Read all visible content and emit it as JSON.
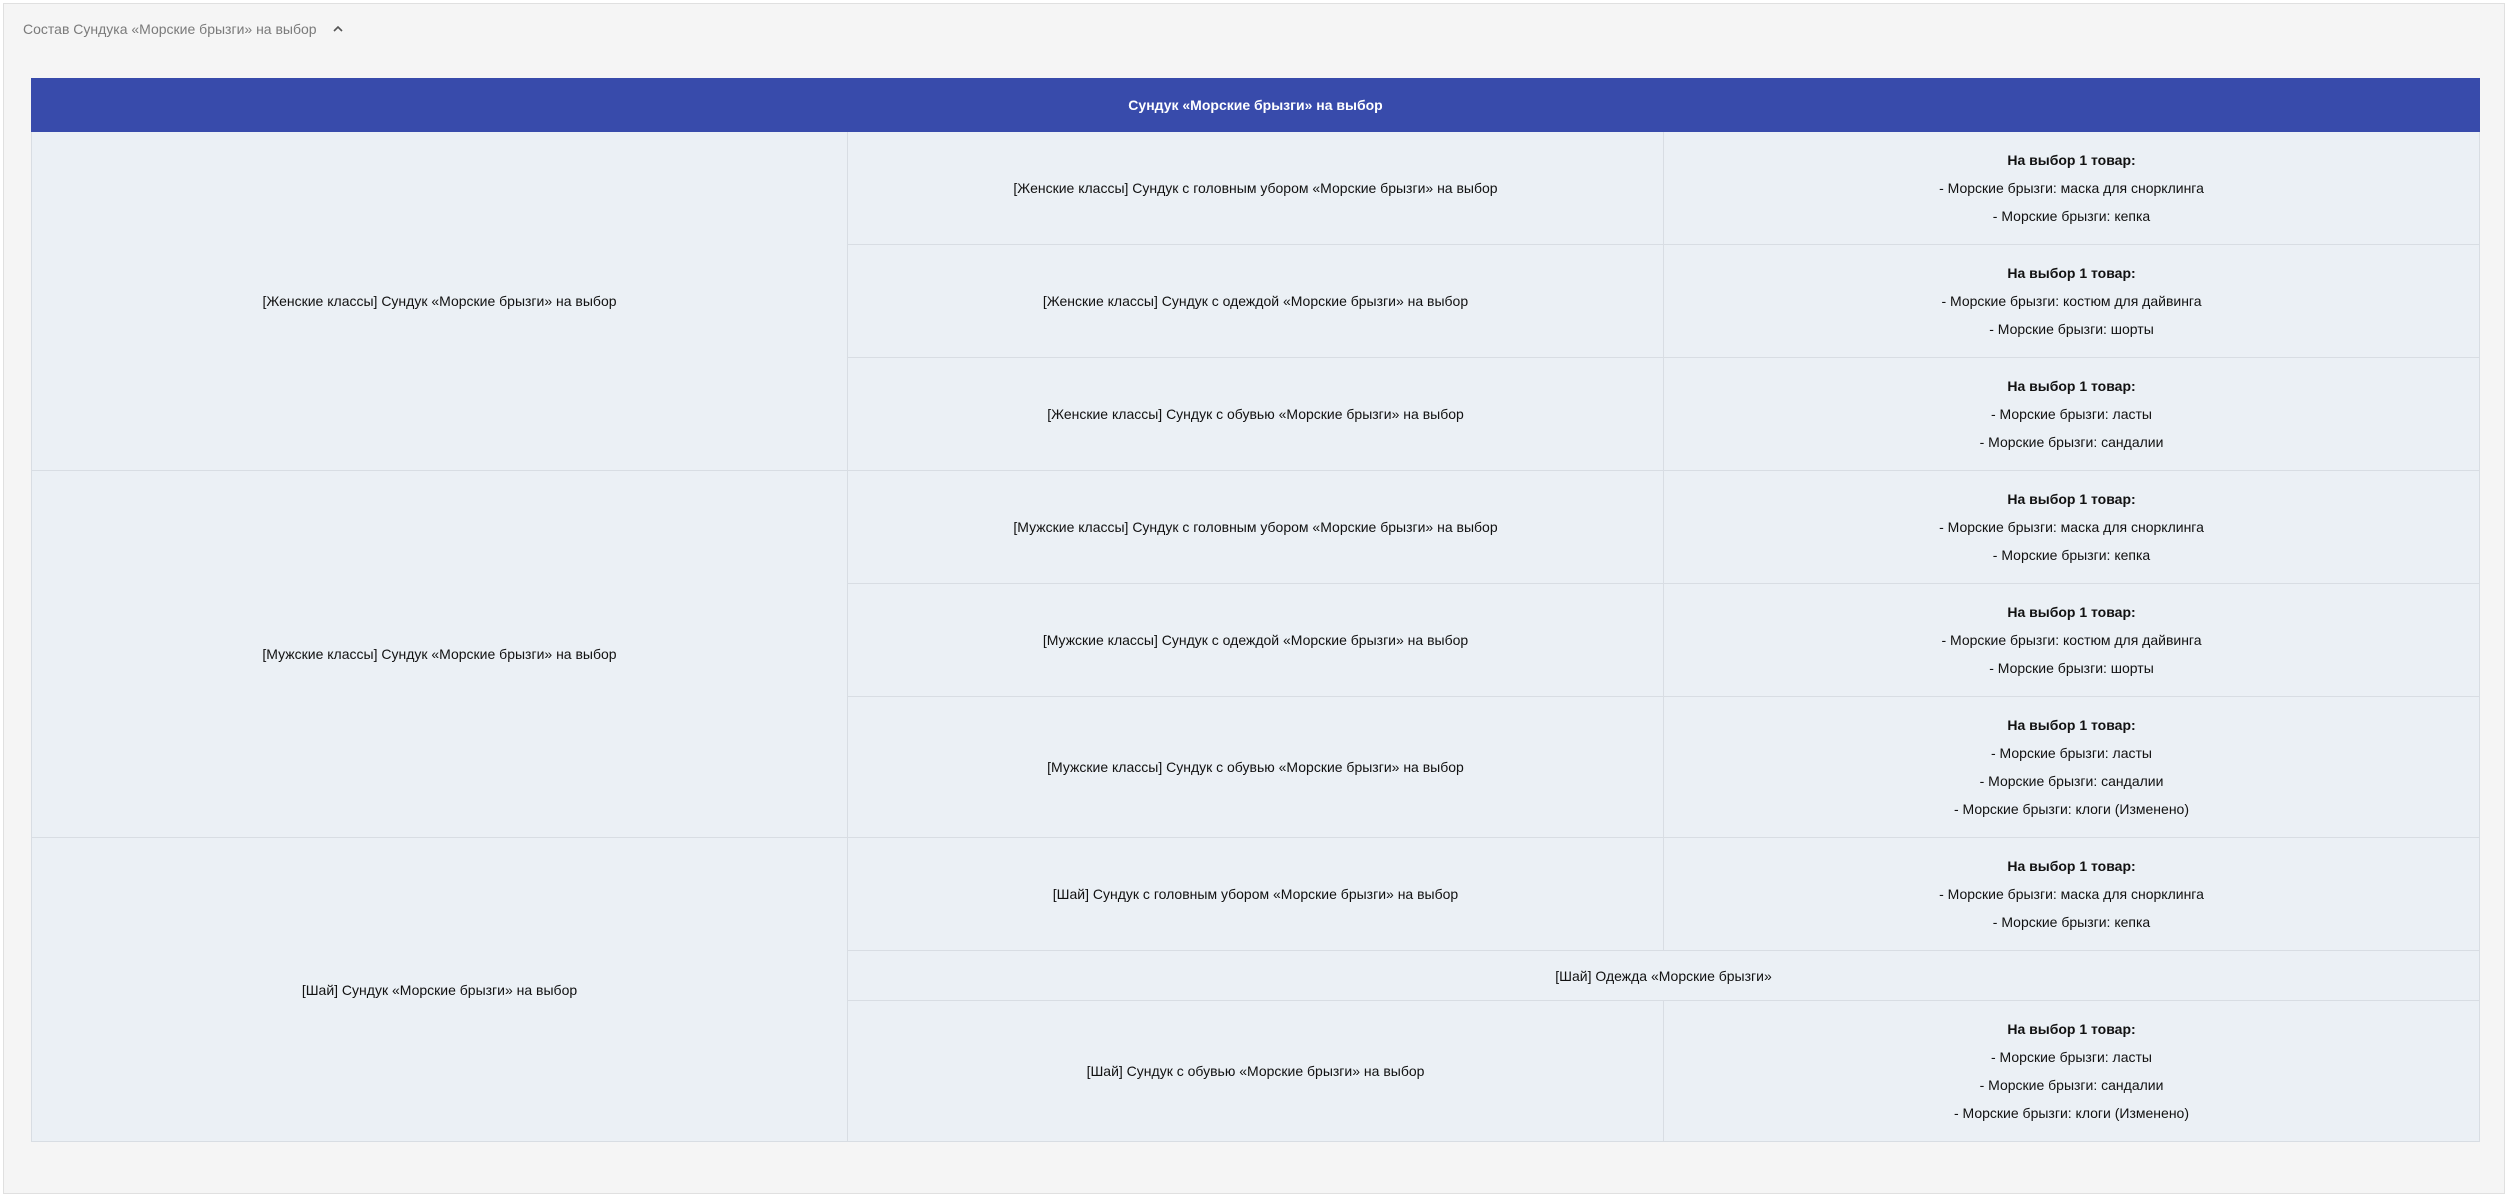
{
  "header": {
    "title": "Состав Сундука «Морские брызги» на выбор"
  },
  "table": {
    "title": "Сундук «Морские брызги» на выбор",
    "groups": [
      {
        "label": "[Женские классы] Сундук «Морские брызги» на выбор",
        "rows": [
          {
            "name": "[Женские классы] Сундук с головным убором «Морские брызги» на выбор",
            "choice_title": "На выбор 1 товар:",
            "items": [
              "- Морские брызги: маска для снорклинга",
              "- Морские брызги: кепка"
            ]
          },
          {
            "name": "[Женские классы] Сундук с одеждой «Морские брызги» на выбор",
            "choice_title": "На выбор 1 товар:",
            "items": [
              "- Морские брызги: костюм для дайвинга",
              "- Морские брызги: шорты"
            ]
          },
          {
            "name": "[Женские классы] Сундук с обувью «Морские брызги» на выбор",
            "choice_title": "На выбор 1 товар:",
            "items": [
              "- Морские брызги: ласты",
              "- Морские брызги: сандалии"
            ]
          }
        ]
      },
      {
        "label": "[Мужские классы] Сундук «Морские брызги» на выбор",
        "rows": [
          {
            "name": "[Мужские классы] Сундук с головным убором «Морские брызги» на выбор",
            "choice_title": "На выбор 1 товар:",
            "items": [
              "- Морские брызги: маска для снорклинга",
              "- Морские брызги: кепка"
            ]
          },
          {
            "name": "[Мужские классы] Сундук с одеждой «Морские брызги» на выбор",
            "choice_title": "На выбор 1 товар:",
            "items": [
              "- Морские брызги: костюм для дайвинга",
              "- Морские брызги: шорты"
            ]
          },
          {
            "name": "[Мужские классы] Сундук с обувью «Морские брызги» на выбор",
            "choice_title": "На выбор 1 товар:",
            "items": [
              "- Морские брызги: ласты",
              "- Морские брызги: сандалии",
              "- Морские брызги: клоги (Изменено)"
            ]
          }
        ]
      },
      {
        "label": "[Шай] Сундук «Морские брызги» на выбор",
        "rows": [
          {
            "name": "[Шай] Сундук с головным убором «Морские брызги» на выбор",
            "choice_title": "На выбор 1 товар:",
            "items": [
              "- Морские брызги: маска для снорклинга",
              "- Морские брызги: кепка"
            ]
          },
          {
            "single": "[Шай] Одежда «Морские брызги»"
          },
          {
            "name": "[Шай] Сундук с обувью «Морские брызги» на выбор",
            "choice_title": "На выбор 1 товар:",
            "items": [
              "- Морские брызги: ласты",
              "- Морские брызги: сандалии",
              "- Морские брызги: клоги (Изменено)"
            ]
          }
        ]
      }
    ]
  },
  "colors": {
    "header_bg": "#384bab",
    "cell_bg": "#ebf0f5",
    "panel_bg": "#f5f5f5"
  }
}
